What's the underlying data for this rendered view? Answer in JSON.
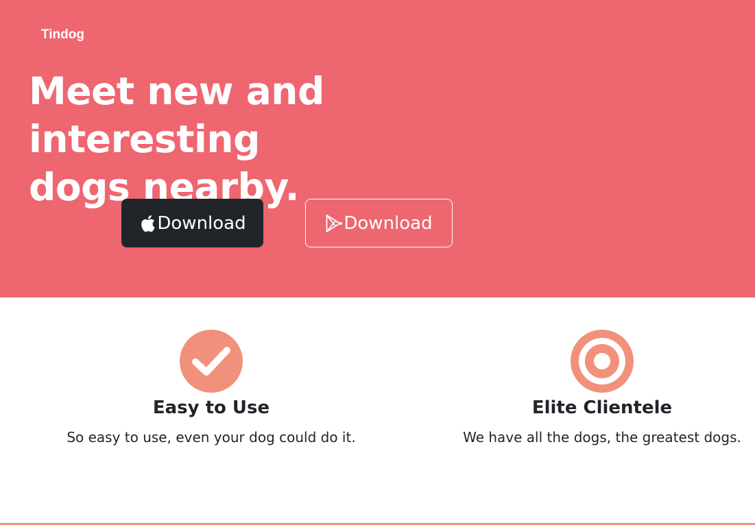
{
  "nav": {
    "brand": "Tindog"
  },
  "hero": {
    "headline_line1": "Meet new and interesting",
    "headline_line2": "dogs nearby.",
    "buttons": [
      {
        "label": "Download",
        "icon": "apple-icon"
      },
      {
        "label": "Download",
        "icon": "google-play-icon"
      }
    ]
  },
  "features": [
    {
      "icon": "check-circle-icon",
      "title": "Easy to Use",
      "description": "So easy to use, even your dog could do it."
    },
    {
      "icon": "bullseye-icon",
      "title": "Elite Clientele",
      "description": "We have all the dogs, the greatest dogs."
    }
  ],
  "colors": {
    "hero_bg": "#ee6670",
    "dark_button": "#212529",
    "feature_icon": "#f2917b",
    "text": "#212529"
  }
}
